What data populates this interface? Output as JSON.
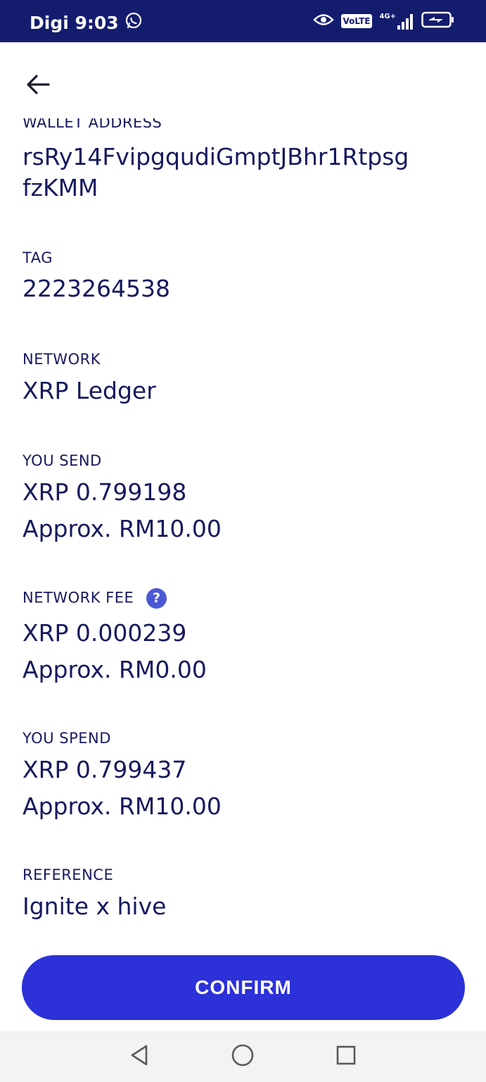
{
  "status_bar": {
    "carrier_time": "Digi 9:03",
    "volte": "VoLTE",
    "network": "4G+"
  },
  "colors": {
    "status_bar_bg": "#141c6e",
    "text": "#16195e",
    "accent": "#2c31d8",
    "help_icon": "#4a58d6"
  },
  "icons": [
    "whatsapp-icon",
    "eye-icon",
    "signal-icon",
    "battery-charging-icon",
    "back-arrow-icon",
    "help-icon",
    "nav-back-icon",
    "nav-home-icon",
    "nav-recents-icon"
  ],
  "details": {
    "wallet_address_label": "WALLET ADDRESS",
    "wallet_address_line1": "rsRy14FvipgqudiGmptJBhr1Rtpsg",
    "wallet_address_line2": "fzKMM",
    "tag_label": "TAG",
    "tag_value": "2223264538",
    "network_label": "NETWORK",
    "network_value": "XRP Ledger",
    "you_send_label": "YOU SEND",
    "you_send_value": "XRP 0.799198",
    "you_send_approx": "Approx. RM10.00",
    "network_fee_label": "NETWORK FEE",
    "network_fee_help": "?",
    "network_fee_value": "XRP 0.000239",
    "network_fee_approx": "Approx. RM0.00",
    "you_spend_label": "YOU SPEND",
    "you_spend_value": "XRP 0.799437",
    "you_spend_approx": "Approx. RM10.00",
    "reference_label": "REFERENCE",
    "reference_value": "Ignite x hive"
  },
  "actions": {
    "confirm_label": "CONFIRM"
  }
}
